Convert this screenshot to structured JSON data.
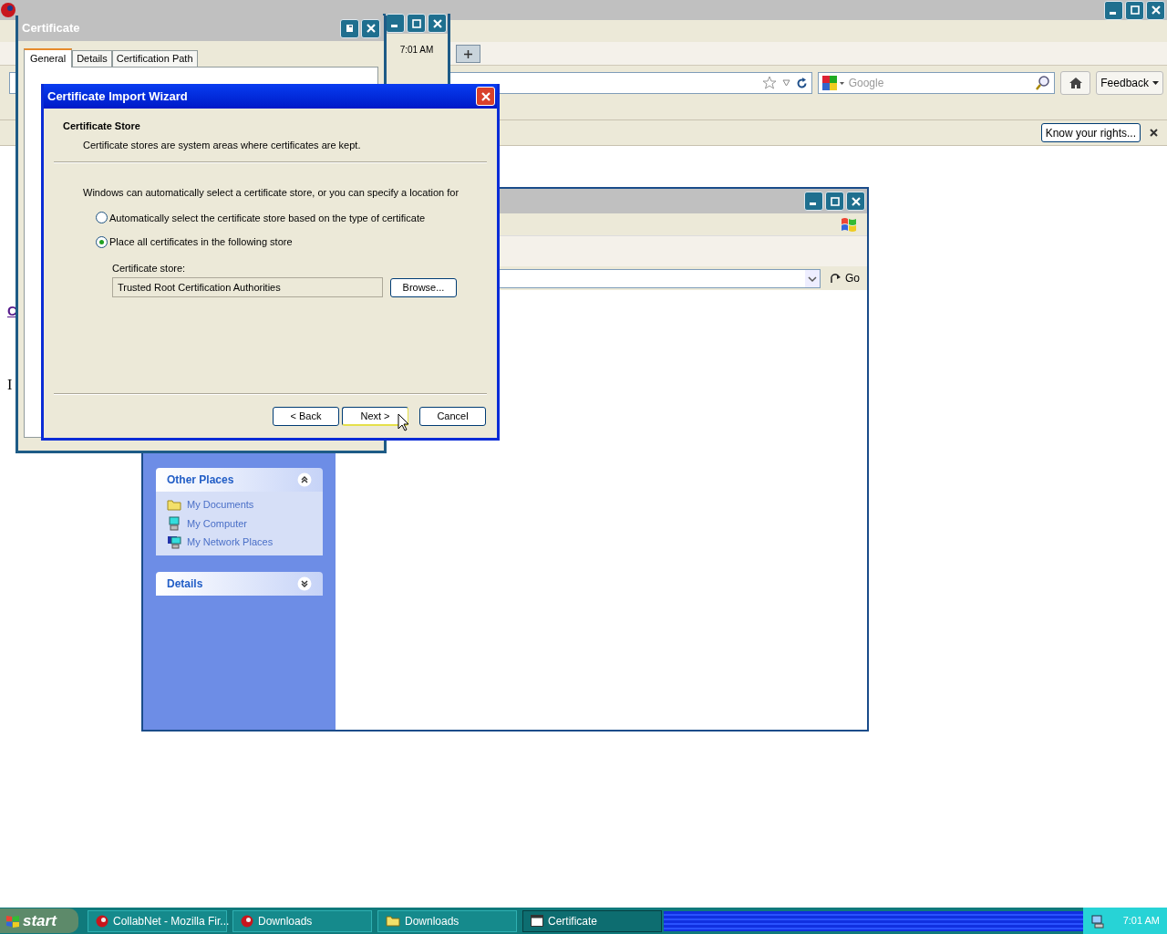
{
  "browser": {
    "search_placeholder": "Google",
    "feedback_button": "Feedback",
    "notification_button": "Know your rights..."
  },
  "page_fragments": [
    {
      "text": "C",
      "kind": "link"
    },
    {
      "text": "I",
      "kind": "text"
    }
  ],
  "clock_window": {
    "time": "7:01 AM"
  },
  "explorer": {
    "go_button": "Go",
    "panels": [
      {
        "title": "Other Places",
        "expanded": true,
        "items": [
          {
            "label": "My Documents",
            "kind": "folder"
          },
          {
            "label": "My Computer",
            "kind": "computer"
          },
          {
            "label": "My Network Places",
            "kind": "network"
          }
        ]
      },
      {
        "title": "Details",
        "expanded": false
      }
    ]
  },
  "certificate_window": {
    "title": "Certificate",
    "tabs": [
      {
        "label": "General",
        "selected": true
      },
      {
        "label": "Details",
        "selected": false
      },
      {
        "label": "Certification Path",
        "selected": false
      }
    ]
  },
  "wizard": {
    "title": "Certificate Import Wizard",
    "heading": "Certificate Store",
    "subheading": "Certificate stores are system areas where certificates are kept.",
    "intro": "Windows can automatically select a certificate store, or you can specify a location for",
    "options": [
      {
        "label": "Automatically select the certificate store based on the type of certificate",
        "selected": false
      },
      {
        "label": "Place all certificates in the following store",
        "selected": true
      }
    ],
    "store_label": "Certificate store:",
    "store_value": "Trusted Root Certification Authorities",
    "browse_button": "Browse...",
    "buttons": [
      {
        "label": "< Back",
        "default": false
      },
      {
        "label": "Next >",
        "default": true
      },
      {
        "label": "Cancel",
        "default": false
      }
    ]
  },
  "taskbar": {
    "start": "start",
    "tasks": [
      {
        "label": "CollabNet - Mozilla Fir...",
        "kind": "browser",
        "selected": false
      },
      {
        "label": "Downloads",
        "kind": "browser",
        "selected": false
      },
      {
        "label": "Downloads",
        "kind": "folder",
        "selected": false
      },
      {
        "label": "Certificate",
        "kind": "window",
        "selected": true
      }
    ],
    "time": "7:01 AM"
  }
}
